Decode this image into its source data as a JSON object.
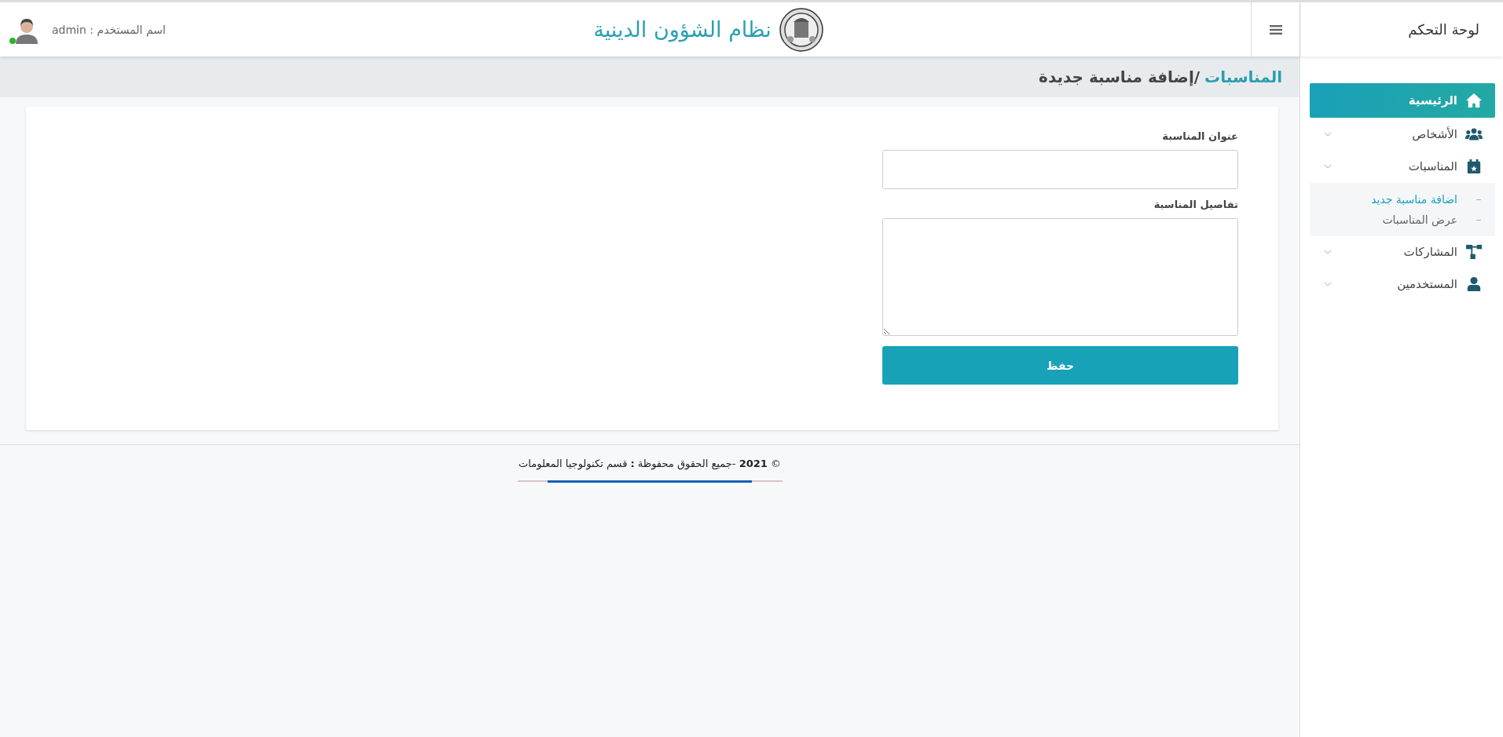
{
  "sidebar": {
    "title": "لوحة التحكم",
    "items": [
      {
        "label": "الرئيسية",
        "kind": "link",
        "selected": true
      },
      {
        "label": "الأشخاص",
        "kind": "menu",
        "selected": false
      },
      {
        "label": "المناسبات",
        "kind": "menu",
        "selected": false,
        "children": [
          {
            "label": "اضافة مناسبة جديد",
            "selected": true
          },
          {
            "label": "عرض المناسبات",
            "selected": false
          }
        ]
      },
      {
        "label": "المشاركات",
        "kind": "menu",
        "selected": false
      },
      {
        "label": "المستخدمين",
        "kind": "menu",
        "selected": false
      }
    ]
  },
  "header": {
    "title": "نظام الشؤون الدينية",
    "user_label": "اسم المستخدم : admin",
    "online": true
  },
  "breadcrumb": {
    "parent": "المناسبات",
    "current": "/إضافة مناسبة جديدة"
  },
  "form": {
    "fields": [
      {
        "kind": "input",
        "label": "عنوان المناسبة"
      },
      {
        "kind": "textarea",
        "label": "تفاصيل المناسبة"
      }
    ],
    "submit": "حفظ"
  },
  "footer": {
    "text": "© **2021** -جميع الحقوق محفوظة **:** قسم تكنولوجيا المعلومات"
  }
}
